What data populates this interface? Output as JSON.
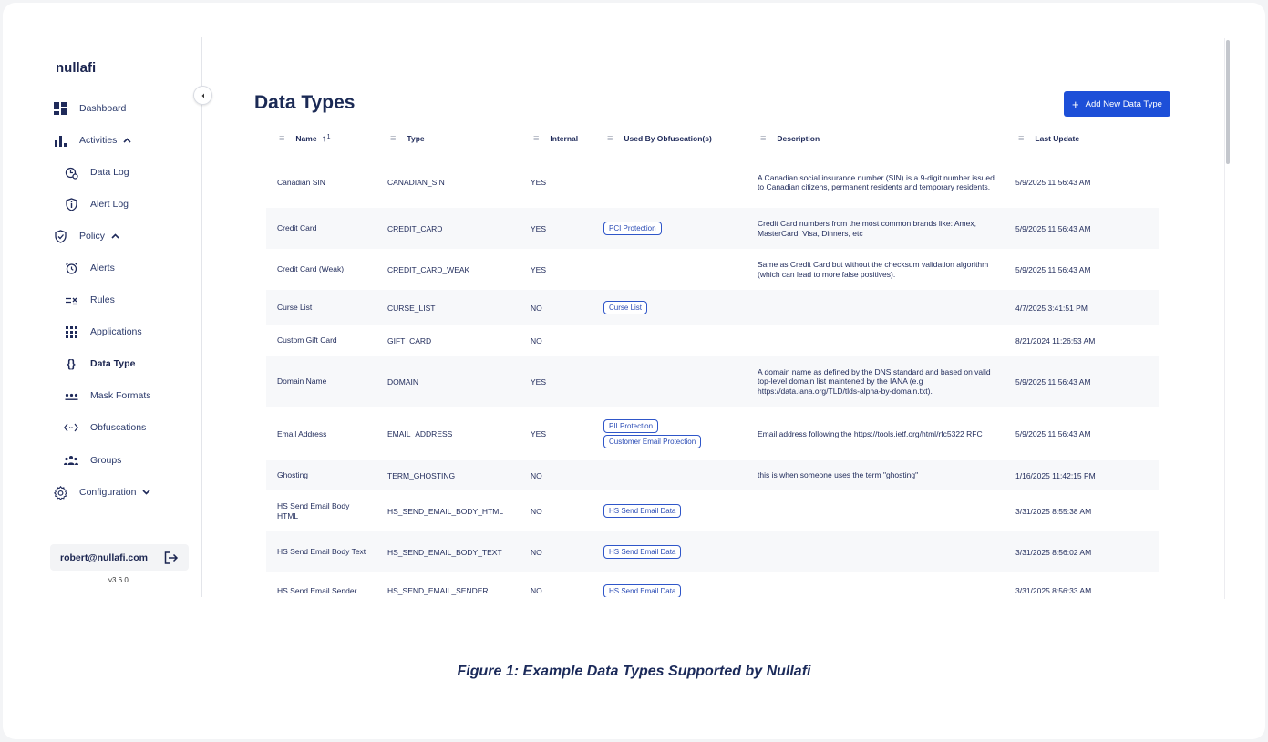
{
  "brand": "nullafi",
  "sidebar": {
    "items": [
      {
        "label": "Dashboard",
        "icon": "dashboard-icon"
      },
      {
        "label": "Activities",
        "icon": "bar-chart-icon",
        "caret": "chevron-up-icon"
      },
      {
        "label": "Data Log",
        "icon": "data-log-icon"
      },
      {
        "label": "Alert Log",
        "icon": "alert-log-icon"
      },
      {
        "label": "Policy",
        "icon": "shield-check-icon",
        "caret": "chevron-up-icon"
      },
      {
        "label": "Alerts",
        "icon": "alarm-clock-icon"
      },
      {
        "label": "Rules",
        "icon": "rules-icon"
      },
      {
        "label": "Applications",
        "icon": "grid-icon"
      },
      {
        "label": "Data Type",
        "icon": "braces-icon",
        "active": true
      },
      {
        "label": "Mask Formats",
        "icon": "mask-format-icon"
      },
      {
        "label": "Obfuscations",
        "icon": "code-arrows-icon"
      },
      {
        "label": "Groups",
        "icon": "groups-icon"
      },
      {
        "label": "Configuration",
        "icon": "gear-icon",
        "caret": "chevron-down-icon"
      }
    ],
    "user_email": "robert@nullafi.com",
    "version": "v3.6.0"
  },
  "main": {
    "title": "Data Types",
    "add_button": "Add New Data Type",
    "columns": {
      "name": "Name",
      "name_sort_order": "1",
      "type": "Type",
      "internal": "Internal",
      "used_by": "Used By Obfuscation(s)",
      "description": "Description",
      "last_update": "Last Update"
    },
    "rows": [
      {
        "name": "Canadian SIN",
        "type": "CANADIAN_SIN",
        "internal": "YES",
        "obf": [],
        "desc": "A Canadian social insurance number (SIN) is a 9-digit number issued to Canadian citizens, permanent residents and temporary residents.",
        "updated": "5/9/2025 11:56:43 AM"
      },
      {
        "name": "Credit Card",
        "type": "CREDIT_CARD",
        "internal": "YES",
        "obf": [
          "PCI Protection"
        ],
        "desc": "Credit Card numbers from the most common brands like: Amex, MasterCard, Visa, Dinners, etc",
        "updated": "5/9/2025 11:56:43 AM"
      },
      {
        "name": "Credit Card (Weak)",
        "type": "CREDIT_CARD_WEAK",
        "internal": "YES",
        "obf": [],
        "desc": "Same as Credit Card but without the checksum validation algorithm (which can lead to more false positives).",
        "updated": "5/9/2025 11:56:43 AM"
      },
      {
        "name": "Curse List",
        "type": "CURSE_LIST",
        "internal": "NO",
        "obf": [
          "Curse List"
        ],
        "desc": "",
        "updated": "4/7/2025 3:41:51 PM"
      },
      {
        "name": "Custom Gift Card",
        "type": "GIFT_CARD",
        "internal": "NO",
        "obf": [],
        "desc": "",
        "updated": "8/21/2024 11:26:53 AM"
      },
      {
        "name": "Domain Name",
        "type": "DOMAIN",
        "internal": "YES",
        "obf": [],
        "desc": "A domain name as defined by the DNS standard and based on valid top-level domain list maintened by the IANA (e.g https://data.iana.org/TLD/tlds-alpha-by-domain.txt).",
        "updated": "5/9/2025 11:56:43 AM"
      },
      {
        "name": "Email Address",
        "type": "EMAIL_ADDRESS",
        "internal": "YES",
        "obf": [
          "PII Protection",
          "Customer Email Protection"
        ],
        "desc": "Email address following the https://tools.ietf.org/html/rfc5322 RFC",
        "updated": "5/9/2025 11:56:43 AM"
      },
      {
        "name": "Ghosting",
        "type": "TERM_GHOSTING",
        "internal": "NO",
        "obf": [],
        "desc": "this is when someone uses the term \"ghosting\"",
        "updated": "1/16/2025 11:42:15 PM"
      },
      {
        "name": "HS Send Email Body HTML",
        "type": "HS_SEND_EMAIL_BODY_HTML",
        "internal": "NO",
        "obf": [
          "HS Send Email Data"
        ],
        "desc": "",
        "updated": "3/31/2025 8:55:38 AM"
      },
      {
        "name": "HS Send Email Body Text",
        "type": "HS_SEND_EMAIL_BODY_TEXT",
        "internal": "NO",
        "obf": [
          "HS Send Email Data"
        ],
        "desc": "",
        "updated": "3/31/2025 8:56:02 AM"
      },
      {
        "name": "HS Send Email Sender",
        "type": "HS_SEND_EMAIL_SENDER",
        "internal": "NO",
        "obf": [
          "HS Send Email Data"
        ],
        "desc": "",
        "updated": "3/31/2025 8:56:33 AM"
      }
    ]
  },
  "caption": "Figure 1: Example Data Types Supported by Nullafi",
  "colors": {
    "accent": "#1d4fd8",
    "text": "#1f2a5a",
    "chip_border": "#2f56c9",
    "row_alt": "#f7f8fa"
  }
}
